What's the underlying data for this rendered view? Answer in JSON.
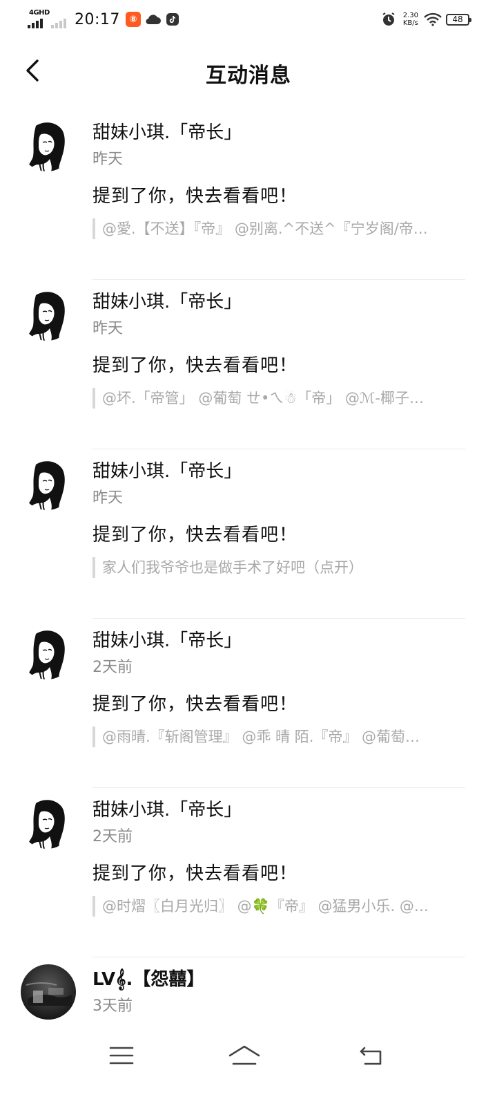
{
  "status_bar": {
    "network": "4GHD",
    "time": "20:17",
    "app_badge": "⑧",
    "net_speed_value": "2.30",
    "net_speed_unit": "KB/s",
    "battery": "48"
  },
  "header": {
    "title": "互动消息"
  },
  "messages": [
    {
      "name": "甜妹小琪.「帝长」",
      "time": "昨天",
      "text": "提到了你，快去看看吧！",
      "quote": "@愛.【不送】『帝』 @别离.^不送^『宁岁阁/帝…"
    },
    {
      "name": "甜妹小琪.「帝长」",
      "time": "昨天",
      "text": "提到了你，快去看看吧！",
      "quote": "@坏.「帝管」 @葡萄 ㄝ•ㄟ☃「帝」 @ℳ-椰子…"
    },
    {
      "name": "甜妹小琪.「帝长」",
      "time": "昨天",
      "text": "提到了你，快去看看吧！",
      "quote": "家人们我爷爷也是做手术了好吧（点开）"
    },
    {
      "name": "甜妹小琪.「帝长」",
      "time": "2天前",
      "text": "提到了你，快去看看吧！",
      "quote": "@雨晴.『斩阁管理』 @乖 晴 陌.『帝』 @葡萄…"
    },
    {
      "name": "甜妹小琪.「帝长」",
      "time": "2天前",
      "text": "提到了你，快去看看吧！",
      "quote": "@时熠〖白月光归〗 @🍀『帝』 @猛男小乐. @…"
    },
    {
      "name": "LV𝄞.【怨囍】",
      "time": "3天前",
      "text": "",
      "quote": ""
    }
  ],
  "icons": {
    "back": "chevron-left-icon",
    "menu": "menu-icon",
    "home": "home-icon",
    "return": "return-icon"
  }
}
